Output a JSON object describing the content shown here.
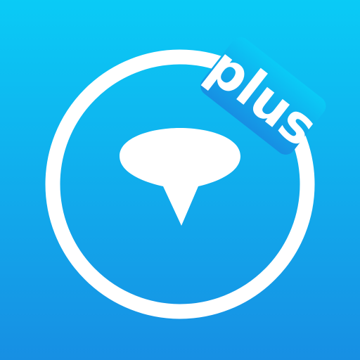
{
  "app_icon": {
    "badge_text": "plus",
    "icon": "speech-pin-icon",
    "colors": {
      "gradient_top": "#0ACBF6",
      "gradient_bottom": "#178FE3",
      "foreground": "#FFFFFF"
    }
  }
}
